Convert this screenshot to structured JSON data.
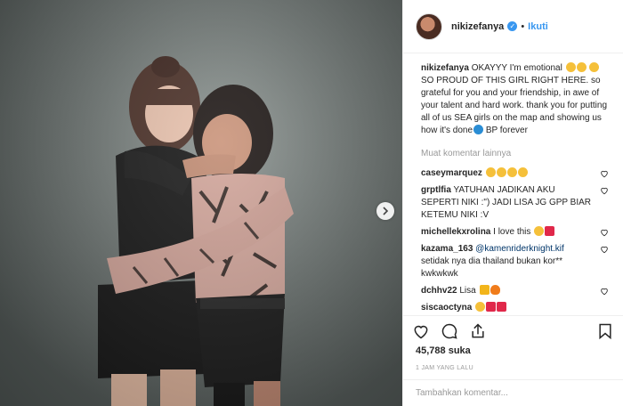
{
  "post": {
    "username": "nikizefanya",
    "verified_mark": "✓",
    "separator": "•",
    "follow_label": "Ikuti",
    "caption": {
      "username": "nikizefanya",
      "text": "OKAYYY I'm emotional",
      "text2": "SO PROUD OF THIS GIRL RIGHT HERE. so grateful for you and your friendship, in awe of your talent and hard work. thank you for putting all of us SEA girls on the map and showing us how it's done",
      "text3": "BP forever"
    },
    "load_more": "Muat komentar lainnya",
    "comments": [
      {
        "username": "caseymarquez",
        "text": ""
      },
      {
        "username": "grptlfia",
        "text": "YATUHAN JADIKAN AKU SEPERTI NIKI :\") JADI LISA JG GPP BIAR KETEMU NIKI :V"
      },
      {
        "username": "michellekxrolina",
        "text": "I love this"
      },
      {
        "username": "kazama_163",
        "mention": "@kamenriderknight.kif",
        "text": "setidak nya dia thailand bukan kor** kwkwkwk"
      },
      {
        "username": "dchhv22",
        "text": "Lisa"
      },
      {
        "username": "siscaoctyna",
        "text": ""
      }
    ],
    "likes": "45,788 suka",
    "time": "1 JAM YANG LALU",
    "comment_placeholder": "Tambahkan komentar..."
  },
  "icons": {
    "like": "heart-icon",
    "comment": "comment-icon",
    "share": "share-icon",
    "save": "bookmark-icon",
    "next": "chevron-right-icon"
  },
  "colors": {
    "accent": "#3897f0",
    "text": "#262626",
    "muted": "#999999",
    "border": "#efefef"
  }
}
